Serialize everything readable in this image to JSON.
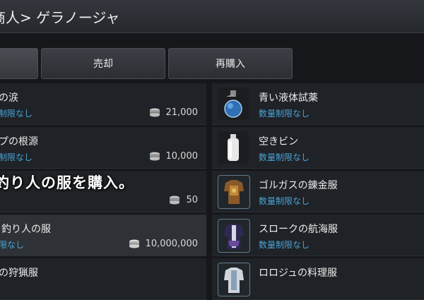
{
  "header": {
    "title": "商人> ゲラノージャ"
  },
  "tabs": [
    {
      "label": ""
    },
    {
      "label": "売却"
    },
    {
      "label": "再購入"
    }
  ],
  "left_items": [
    {
      "name": "の涙",
      "limit": "制限なし",
      "price": "21,000"
    },
    {
      "name": "プの根源",
      "limit": "制限なし",
      "price": "10,000"
    },
    {
      "name": "",
      "limit": "",
      "price": "50"
    },
    {
      "name": "釣り人の服",
      "limit": "限なし",
      "price": "10,000,000"
    },
    {
      "name": "の狩猟服",
      "limit": "",
      "price": ""
    }
  ],
  "right_items": [
    {
      "name": "青い液体試薬",
      "limit": "数量制限なし",
      "icon": "potion-icon"
    },
    {
      "name": "空きビン",
      "limit": "数量制限なし",
      "icon": "empty-bottle-icon"
    },
    {
      "name": "ゴルガスの錬金服",
      "limit": "数量制限なし",
      "icon": "alchemy-outfit-icon"
    },
    {
      "name": "スロークの航海服",
      "limit": "数量制限なし",
      "icon": "sailing-outfit-icon"
    },
    {
      "name": "ロロジュの料理服",
      "limit": "",
      "icon": "cooking-outfit-icon"
    }
  ],
  "overlay": {
    "caption": "釣り人の服を購入。"
  },
  "colors": {
    "limit_text": "#4aa4d8",
    "background": "#15171b"
  }
}
